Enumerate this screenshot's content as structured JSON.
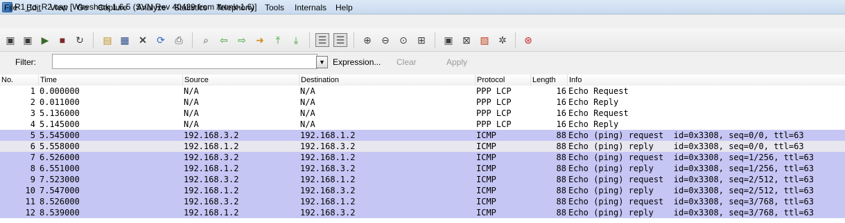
{
  "window": {
    "title": "R1_to_R2.cap  [Wireshark 1.6.5  (SVN Rev 40429 from /trunk-1.6)]"
  },
  "menu": [
    "File",
    "Edit",
    "View",
    "Go",
    "Capture",
    "Analyze",
    "Statistics",
    "Telephony",
    "Tools",
    "Internals",
    "Help"
  ],
  "toolbar": {
    "icons": [
      "interface-list-icon",
      "capture-options-icon",
      "start-capture-icon",
      "stop-capture-icon",
      "restart-capture-icon",
      "open-file-icon",
      "save-file-icon",
      "close-file-icon",
      "reload-icon",
      "print-icon",
      "find-icon",
      "go-back-icon",
      "go-forward-icon",
      "go-to-packet-icon",
      "go-first-icon",
      "go-last-icon",
      "colorize-icon",
      "autoscroll-icon",
      "zoom-in-icon",
      "zoom-out-icon",
      "zoom-normal-icon",
      "resize-columns-icon",
      "capture-filters-icon",
      "display-filters-icon",
      "coloring-rules-icon",
      "preferences-icon",
      "help-icon"
    ]
  },
  "filter": {
    "label": "Filter:",
    "value": "",
    "expression_label": "Expression...",
    "clear_label": "Clear",
    "apply_label": "Apply"
  },
  "columns": [
    "No.",
    "Time",
    "Source",
    "Destination",
    "Protocol",
    "Length",
    "Info"
  ],
  "colors": {
    "icmp_row": "#c6c6f5",
    "icmp_row_alt": "#e8e6ee",
    "ppp_row": "#ffffff"
  },
  "packets": [
    {
      "no": "1",
      "time": "0.000000",
      "source": "N/A",
      "destination": "N/A",
      "protocol": "PPP LCP",
      "length": "16",
      "info": "Echo Request"
    },
    {
      "no": "2",
      "time": "0.011000",
      "source": "N/A",
      "destination": "N/A",
      "protocol": "PPP LCP",
      "length": "16",
      "info": "Echo Reply"
    },
    {
      "no": "3",
      "time": "5.136000",
      "source": "N/A",
      "destination": "N/A",
      "protocol": "PPP LCP",
      "length": "16",
      "info": "Echo Request"
    },
    {
      "no": "4",
      "time": "5.145000",
      "source": "N/A",
      "destination": "N/A",
      "protocol": "PPP LCP",
      "length": "16",
      "info": "Echo Reply"
    },
    {
      "no": "5",
      "time": "5.545000",
      "source": "192.168.3.2",
      "destination": "192.168.1.2",
      "protocol": "ICMP",
      "length": "88",
      "info": "Echo (ping) request  id=0x3308, seq=0/0, ttl=63"
    },
    {
      "no": "6",
      "time": "5.558000",
      "source": "192.168.1.2",
      "destination": "192.168.3.2",
      "protocol": "ICMP",
      "length": "88",
      "info": "Echo (ping) reply    id=0x3308, seq=0/0, ttl=63"
    },
    {
      "no": "7",
      "time": "6.526000",
      "source": "192.168.3.2",
      "destination": "192.168.1.2",
      "protocol": "ICMP",
      "length": "88",
      "info": "Echo (ping) request  id=0x3308, seq=1/256, ttl=63"
    },
    {
      "no": "8",
      "time": "6.551000",
      "source": "192.168.1.2",
      "destination": "192.168.3.2",
      "protocol": "ICMP",
      "length": "88",
      "info": "Echo (ping) reply    id=0x3308, seq=1/256, ttl=63"
    },
    {
      "no": "9",
      "time": "7.523000",
      "source": "192.168.3.2",
      "destination": "192.168.1.2",
      "protocol": "ICMP",
      "length": "88",
      "info": "Echo (ping) request  id=0x3308, seq=2/512, ttl=63"
    },
    {
      "no": "10",
      "time": "7.547000",
      "source": "192.168.1.2",
      "destination": "192.168.3.2",
      "protocol": "ICMP",
      "length": "88",
      "info": "Echo (ping) reply    id=0x3308, seq=2/512, ttl=63"
    },
    {
      "no": "11",
      "time": "8.526000",
      "source": "192.168.3.2",
      "destination": "192.168.1.2",
      "protocol": "ICMP",
      "length": "88",
      "info": "Echo (ping) request  id=0x3308, seq=3/768, ttl=63"
    },
    {
      "no": "12",
      "time": "8.539000",
      "source": "192.168.1.2",
      "destination": "192.168.3.2",
      "protocol": "ICMP",
      "length": "88",
      "info": "Echo (ping) reply    id=0x3308, seq=3/768, ttl=63"
    }
  ]
}
